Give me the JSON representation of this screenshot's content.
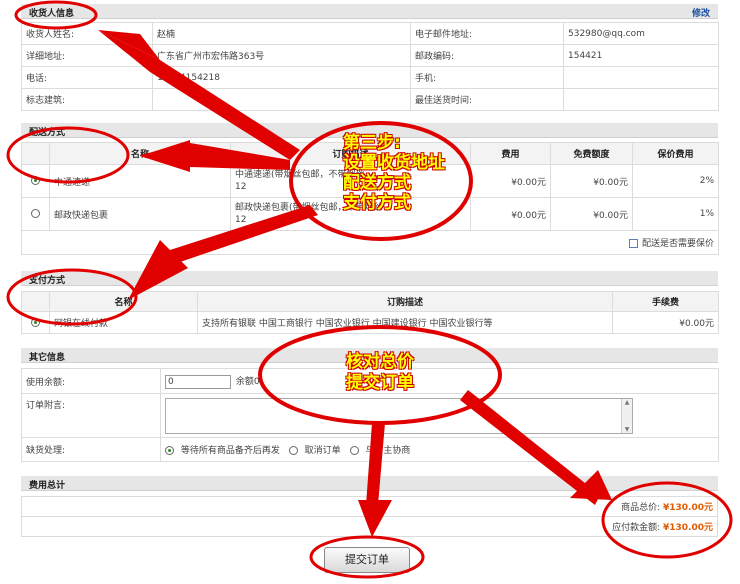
{
  "recipient": {
    "title": "收货人信息",
    "edit_label": "修改",
    "rows": [
      {
        "l1": "收货人姓名:",
        "v1": "赵楠",
        "l2": "电子邮件地址:",
        "v2": "532980@qq.com"
      },
      {
        "l1": "详细地址:",
        "v1": "广东省广州市宏伟路363号",
        "l2": "邮政编码:",
        "v2": "154421"
      },
      {
        "l1": "电话:",
        "v1": "13154154218",
        "l2": "手机:",
        "v2": ""
      },
      {
        "l1": "标志建筑:",
        "v1": "",
        "l2": "最佳送货时间:",
        "v2": ""
      }
    ]
  },
  "shipping": {
    "title": "配送方式",
    "headers": [
      "名称",
      "订购描述",
      "费用",
      "免费额度",
      "保价费用"
    ],
    "rows": [
      {
        "name": "中通速递",
        "desc1": "中通速递(带烟丝包邮，不带烟丝",
        "desc2": "12",
        "fee": "¥0.00元",
        "free": "¥0.00元",
        "insure": "2%",
        "selected": true
      },
      {
        "name": "邮政快递包裹",
        "desc1": "邮政快递包裹(带烟丝包邮，不带烟丝",
        "desc2": "12",
        "fee": "¥0.00元",
        "free": "¥0.00元",
        "insure": "1%",
        "selected": false
      }
    ],
    "insure_label": "配送是否需要保价"
  },
  "payment": {
    "title": "支付方式",
    "headers": [
      "名称",
      "订购描述",
      "手续费"
    ],
    "rows": [
      {
        "name": "网银在线付款",
        "desc": "支持所有银联 中国工商银行 中国农业银行 中国建设银行 中国农业银行等",
        "fee": "¥0.00元",
        "selected": true
      }
    ]
  },
  "other": {
    "title": "其它信息",
    "balance_label": "使用余额:",
    "balance_value": "0",
    "balance_note": "余额0",
    "message_label": "订单附言:",
    "shortage_label": "缺货处理:",
    "shortage_options": [
      {
        "label": "等待所有商品备齐后再发",
        "selected": true
      },
      {
        "label": "取消订单",
        "selected": false
      },
      {
        "label": "与店主协商",
        "selected": false
      }
    ]
  },
  "totals": {
    "title": "费用总计",
    "goods_label": "商品总价:",
    "goods_value": "¥130.00元",
    "payable_label": "应付款金额:",
    "payable_value": "¥130.00元"
  },
  "submit_label": "提交订单",
  "annotations": {
    "step3": [
      "第三步:",
      "设置收货地址",
      "配送方式",
      "支付方式"
    ],
    "check": [
      "核对总价",
      "提交订单"
    ]
  },
  "colors": {
    "annotation": "#e00000",
    "annotation_text": "#ffff00",
    "price": "#e05a00",
    "link": "#1a4fa0"
  }
}
